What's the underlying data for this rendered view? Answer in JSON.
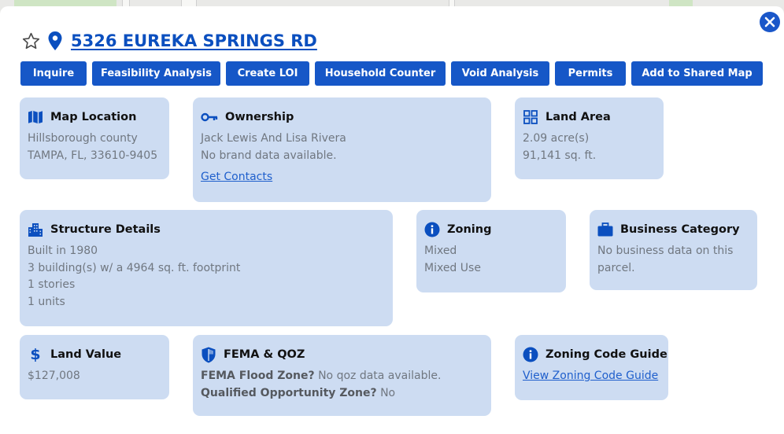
{
  "header": {
    "address": "5326 EUREKA SPRINGS RD"
  },
  "toolbar": {
    "buttons": [
      {
        "label": "Inquire"
      },
      {
        "label": "Feasibility Analysis"
      },
      {
        "label": "Create LOI"
      },
      {
        "label": "Household Counter"
      },
      {
        "label": "Void Analysis"
      },
      {
        "label": "Permits"
      },
      {
        "label": "Add to Shared Map"
      }
    ]
  },
  "cards": {
    "map_location": {
      "title": "Map Location",
      "county": "Hillsborough county",
      "city": "TAMPA, FL, 33610-9405"
    },
    "ownership": {
      "title": "Ownership",
      "owner": "Jack Lewis And Lisa Rivera",
      "brand": "No brand data available.",
      "link": "Get Contacts"
    },
    "land_area": {
      "title": "Land Area",
      "acres": "2.09 acre(s)",
      "sqft": "91,141 sq. ft."
    },
    "structure": {
      "title": "Structure Details",
      "built": "Built in 1980",
      "buildings": "3 building(s) w/ a 4964 sq. ft. footprint",
      "stories": "1 stories",
      "units": "1 units"
    },
    "zoning": {
      "title": "Zoning",
      "code": "Mixed",
      "desc": "Mixed Use"
    },
    "business": {
      "title": "Business Category",
      "text": "No business data on this parcel."
    },
    "land_value": {
      "title": "Land Value",
      "value": "$127,008"
    },
    "fema": {
      "title": "FEMA & QOZ",
      "flood_label": "FEMA Flood Zone?",
      "flood_value": " No qoz data available.",
      "qoz_label": "Qualified Opportunity Zone?",
      "qoz_value": " No"
    },
    "zoning_guide": {
      "title": "Zoning Code Guide",
      "link": "View Zoning Code Guide"
    }
  },
  "colors": {
    "accent": "#1657c7",
    "card_bg": "#cddcf2",
    "link": "#1f5fcc"
  }
}
